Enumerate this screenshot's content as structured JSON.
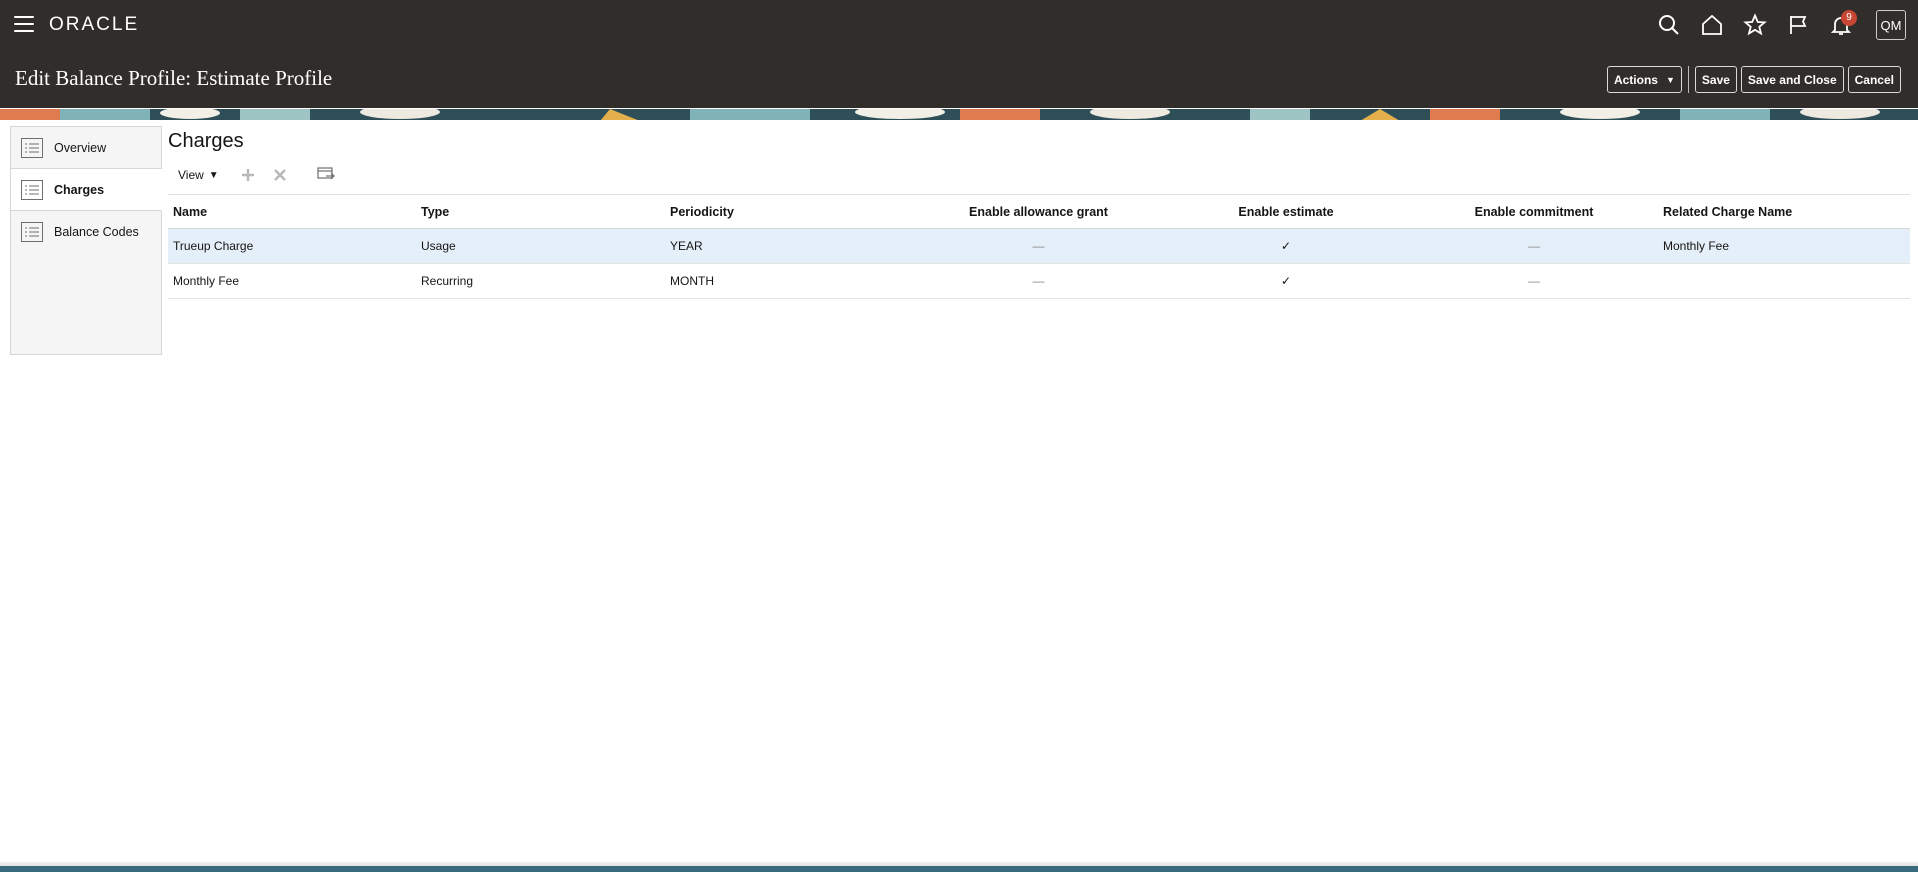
{
  "header": {
    "brand": "ORACLE",
    "page_title": "Edit Balance Profile: Estimate Profile",
    "notification_count": "9",
    "avatar_initials": "QM",
    "icons": [
      "hamburger-icon",
      "search-icon",
      "home-icon",
      "star-icon",
      "flag-icon",
      "bell-icon"
    ],
    "actions": {
      "actions_label": "Actions",
      "save_label": "Save",
      "save_close_label": "Save and Close",
      "cancel_label": "Cancel"
    },
    "colors": {
      "bar": "#312d2a",
      "badge": "#c74634"
    }
  },
  "left_nav": {
    "items": [
      {
        "label": "Overview",
        "active": false
      },
      {
        "label": "Charges",
        "active": true
      },
      {
        "label": "Balance Codes",
        "active": false
      }
    ]
  },
  "main": {
    "section_title": "Charges",
    "toolbar": {
      "view_label": "View",
      "icons": [
        "add-icon",
        "delete-icon",
        "detach-icon"
      ]
    },
    "table": {
      "columns": [
        "Name",
        "Type",
        "Periodicity",
        "Enable allowance grant",
        "Enable estimate",
        "Enable commitment",
        "Related Charge Name"
      ],
      "rows": [
        {
          "name": "Trueup Charge",
          "type": "Usage",
          "periodicity": "YEAR",
          "allowance": "—",
          "estimate": "✓",
          "commitment": "—",
          "related": "Monthly Fee",
          "selected": true
        },
        {
          "name": "Monthly Fee",
          "type": "Recurring",
          "periodicity": "MONTH",
          "allowance": "—",
          "estimate": "✓",
          "commitment": "—",
          "related": "",
          "selected": false
        }
      ]
    },
    "colors": {
      "selected_row": "#e4effa"
    }
  }
}
